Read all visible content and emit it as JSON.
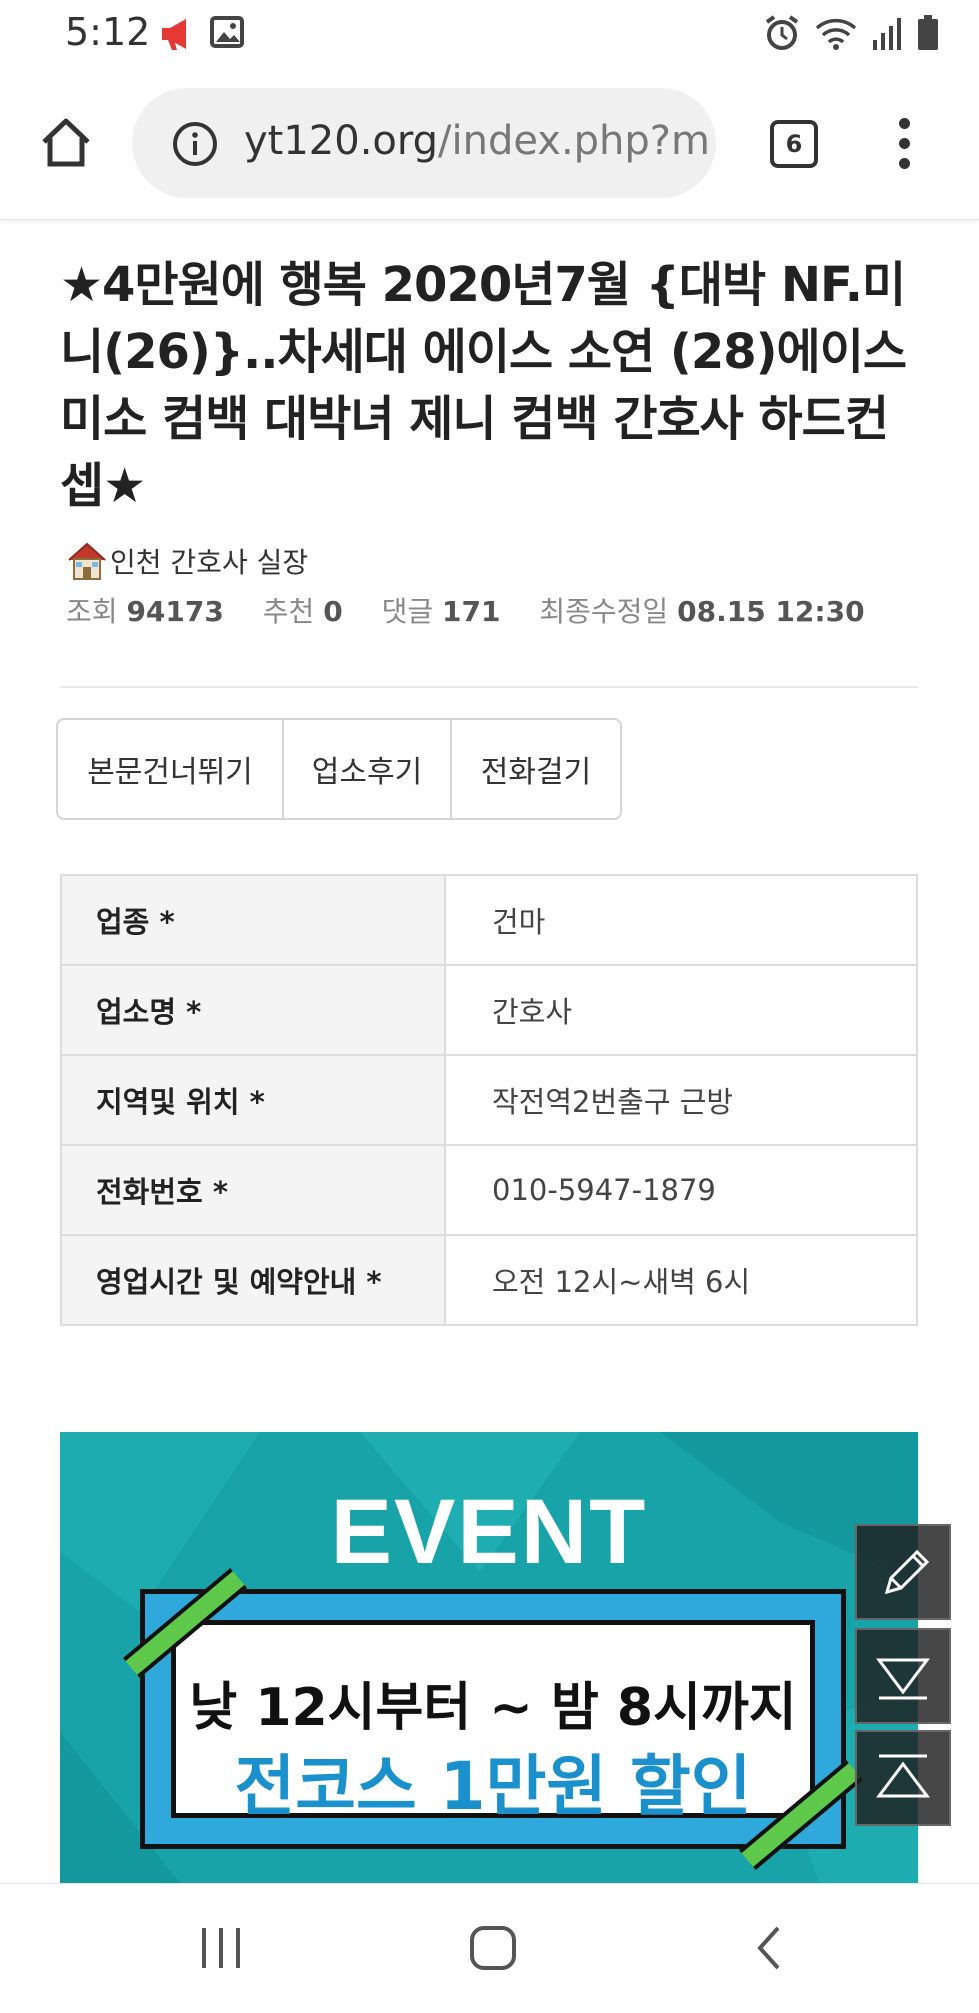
{
  "status_bar": {
    "time": "5:12",
    "left_icons": [
      "megaphone-icon",
      "image-icon"
    ],
    "right_icons": [
      "alarm-icon",
      "wifi-icon",
      "signal-icon",
      "battery-icon"
    ]
  },
  "browser": {
    "url_main": "yt120.org",
    "url_path": "/index.php?m",
    "tab_count": "6"
  },
  "post": {
    "title": "★4만원에 행복 2020년7월 {대박 NF.미니(26)}..차세대 에이스 소연 (28)에이스 미소 컴백 대박녀 제니 컴백 간호사 하드컨셉★",
    "author": "인천 간호사 실장",
    "meta": {
      "views_label": "조회",
      "views": "94173",
      "likes_label": "추천",
      "likes": "0",
      "comments_label": "댓글",
      "comments": "171",
      "updated_label": "최종수정일",
      "updated": "08.15 12:30"
    }
  },
  "buttons": {
    "skip": "본문건너뛰기",
    "review": "업소후기",
    "call": "전화걸기"
  },
  "info_table": {
    "rows": [
      {
        "key": "업종 *",
        "value": "건마"
      },
      {
        "key": "업소명 *",
        "value": "간호사"
      },
      {
        "key": "지역및 위치 *",
        "value": "작전역2번출구 근방"
      },
      {
        "key": "전화번호 *",
        "value": "010-5947-1879"
      },
      {
        "key": "영업시간 및 예약안내 *",
        "value": "오전 12시~새벽 6시"
      }
    ]
  },
  "banner": {
    "heading": "EVENT",
    "line1": "낮 12시부터 ~ 밤 8시까지",
    "line2": "전코스 1만원 할인",
    "colors": {
      "background": "#18a3a8",
      "frame": "#2fa8dc",
      "accent_text": "#1a90cc",
      "ribbon": "#5ec84a"
    }
  },
  "floating_buttons": [
    "pencil-icon",
    "scroll-down-icon",
    "scroll-up-icon"
  ],
  "nav_bar": [
    "recent-apps-icon",
    "home-icon",
    "back-icon"
  ]
}
